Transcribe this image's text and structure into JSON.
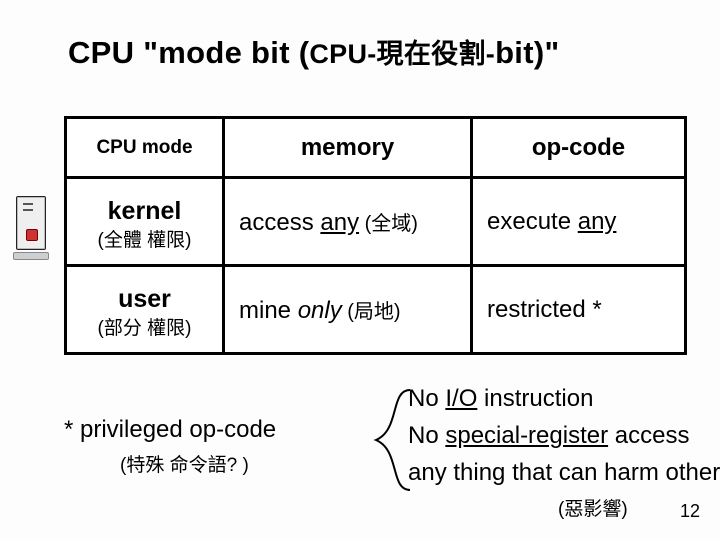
{
  "title": {
    "main": "CPU \"mode bit (",
    "sub": "CPU-現在役割-",
    "tail": "bit)\""
  },
  "table": {
    "head": {
      "c0": "CPU mode",
      "c1": "memory",
      "c2": "op-code"
    },
    "row1": {
      "label_main": "kernel",
      "label_sub": "(全體 權限)",
      "mem_pre": "access ",
      "mem_ul": "any",
      "mem_anno": " (全域)",
      "op_pre": "execute ",
      "op_ul": "any"
    },
    "row2": {
      "label_main": "user",
      "label_sub": "(部分 權限)",
      "mem_pre": "mine  ",
      "mem_it": "only",
      "mem_anno": " (局地)",
      "op_pre": "restricted ",
      "op_ast": "*"
    }
  },
  "list": {
    "l1a": "No ",
    "l1b": "I/O",
    "l1c": " instruction",
    "l2a": "No  ",
    "l2b": "special-register",
    "l2c": " access",
    "l3": "any thing that can harm others"
  },
  "priv": {
    "line": "* privileged op-code",
    "sub": "(特殊  命令語? )"
  },
  "harm_sub": "(惡影響)",
  "pagenum": "12"
}
